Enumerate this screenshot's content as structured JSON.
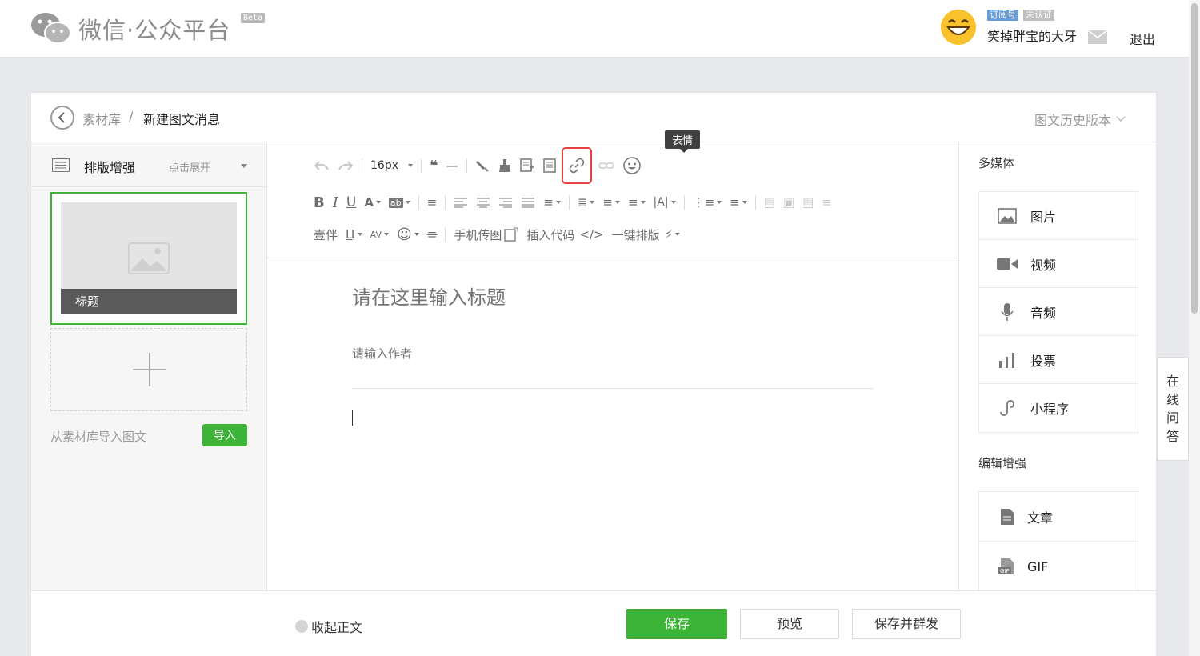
{
  "header": {
    "logo_text": "微信·公众平台",
    "beta": "Beta",
    "badge_subscription": "订阅号",
    "badge_unverified": "未认证",
    "account_name": "笑掉胖宝的大牙",
    "logout": "退出"
  },
  "breadcrumb": {
    "root": "素材库",
    "separator": "/",
    "current": "新建图文消息",
    "history": "图文历史版本"
  },
  "left": {
    "enhance_title": "排版增强",
    "enhance_expand": "点击展开",
    "article_title": "标题",
    "import_label": "从素材库导入图文",
    "import_button": "导入"
  },
  "toolbar": {
    "font_size": "16px",
    "tooltip": "表情",
    "row3": {
      "font_family": "壹伴",
      "phone_upload": "手机传图",
      "insert_code": "插入代码",
      "one_click": "一键排版"
    }
  },
  "editor": {
    "title_placeholder": "请在这里输入标题",
    "author_placeholder": "请输入作者"
  },
  "right": {
    "multimedia_title": "多媒体",
    "multimedia": [
      {
        "label": "图片",
        "icon": "image-icon"
      },
      {
        "label": "视频",
        "icon": "video-icon"
      },
      {
        "label": "音频",
        "icon": "microphone-icon"
      },
      {
        "label": "投票",
        "icon": "bar-chart-icon"
      },
      {
        "label": "小程序",
        "icon": "mini-program-icon"
      }
    ],
    "edit_title": "编辑增强",
    "edit": [
      {
        "label": "文章",
        "icon": "document-icon"
      },
      {
        "label": "GIF",
        "icon": "gif-icon"
      }
    ]
  },
  "bottom": {
    "collapse": "收起正文",
    "save": "保存",
    "preview": "预览",
    "save_publish": "保存并群发"
  },
  "qa": [
    "在",
    "线",
    "问",
    "答"
  ],
  "colors": {
    "accent_green": "#3db338",
    "highlight_red": "#e64340"
  }
}
